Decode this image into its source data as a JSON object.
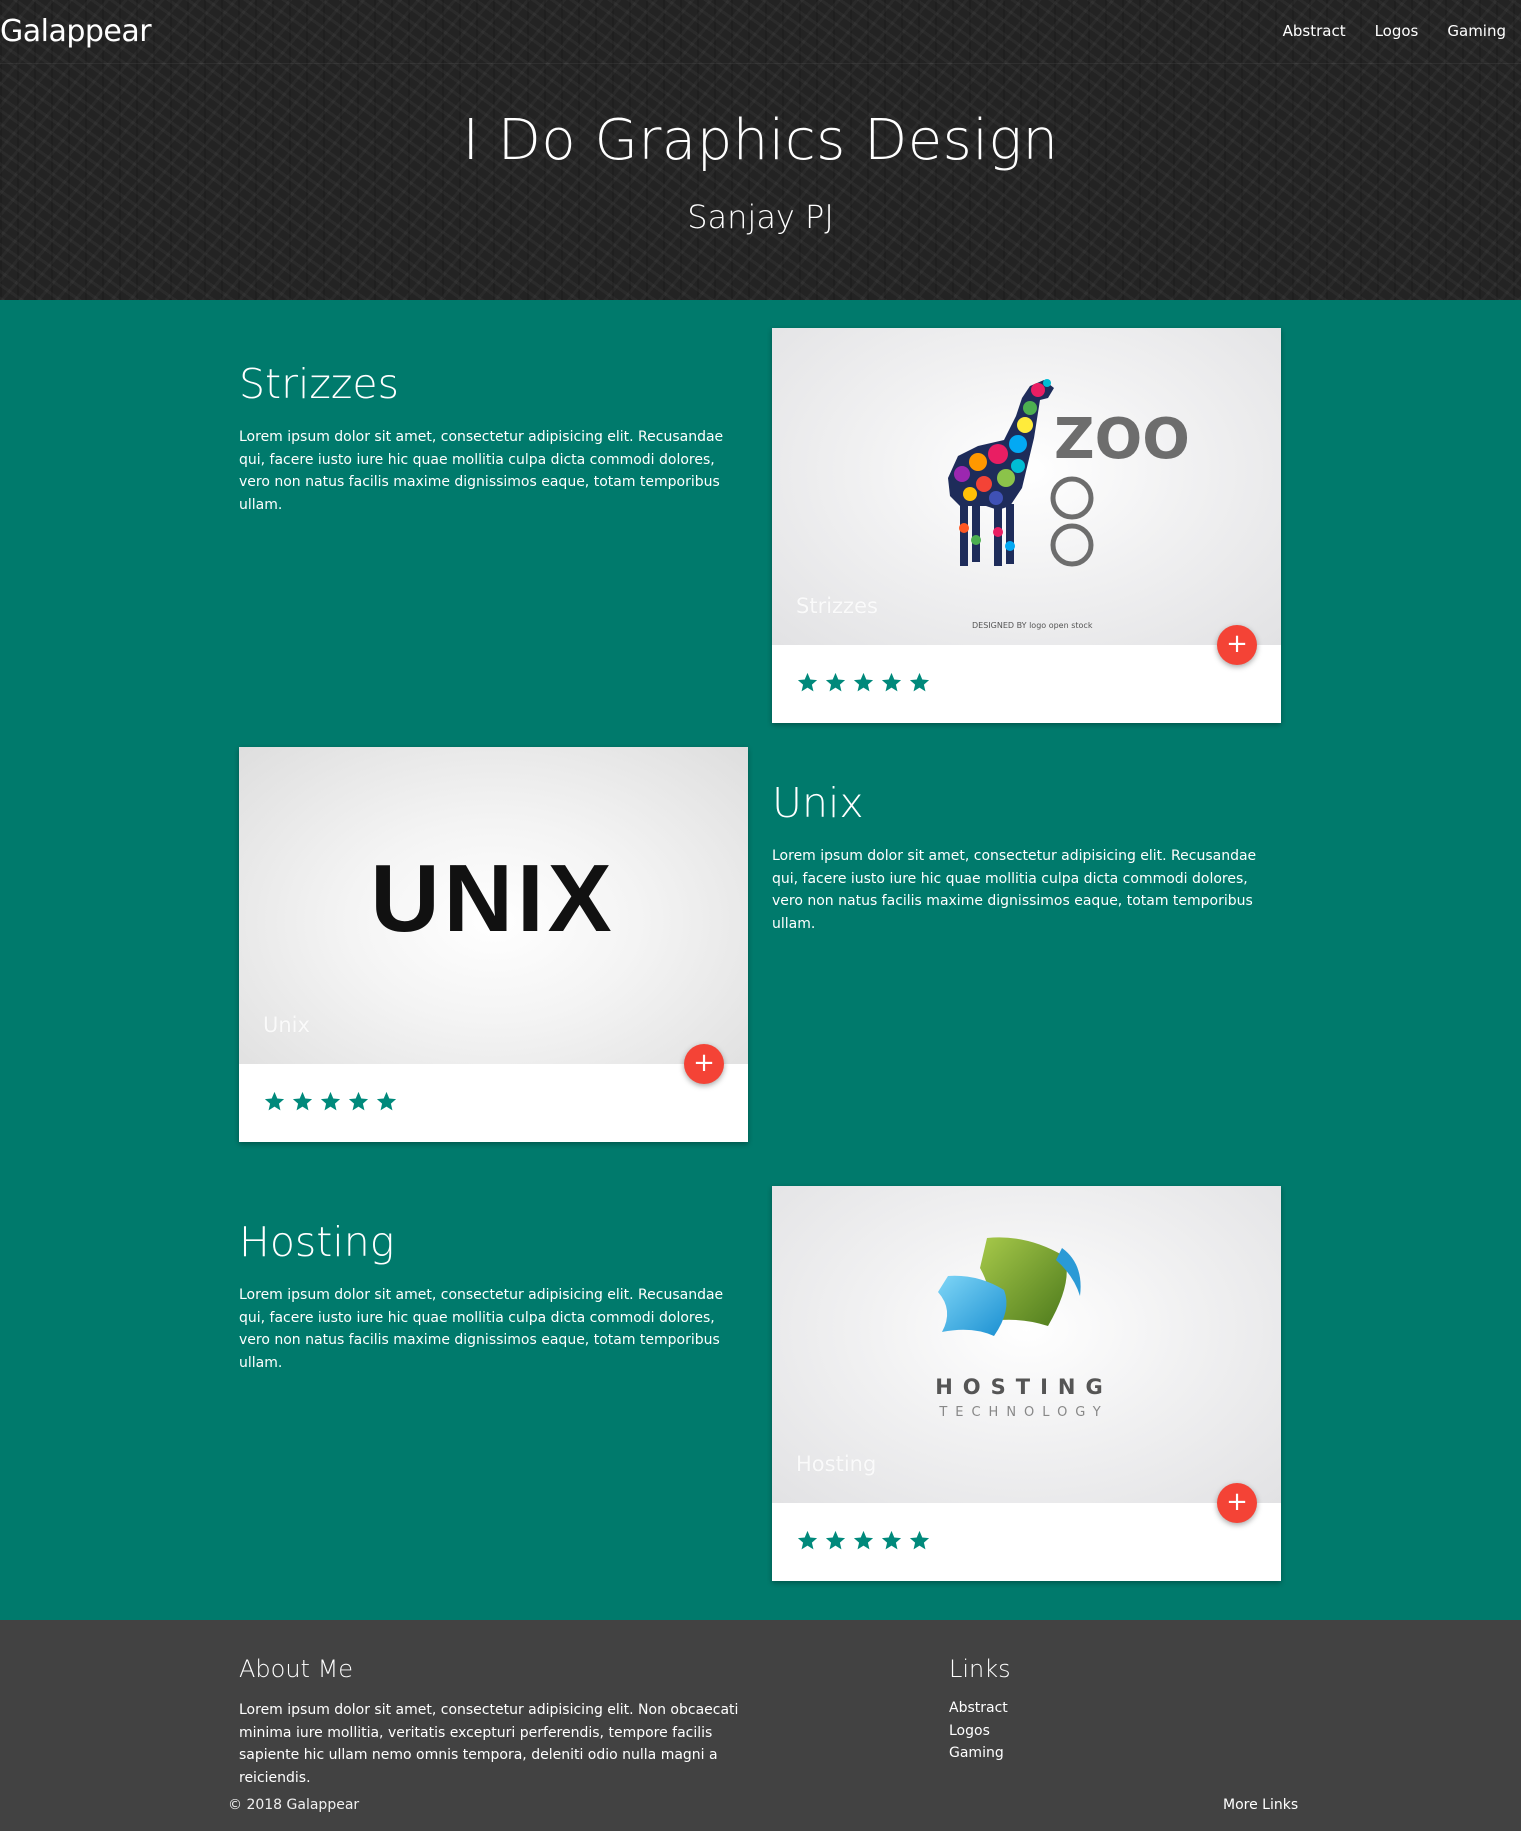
{
  "nav": {
    "brand": "Galappear",
    "links": [
      "Abstract",
      "Logos",
      "Gaming"
    ]
  },
  "hero": {
    "title": "I Do Graphics Design",
    "subtitle": "Sanjay PJ"
  },
  "sections": [
    {
      "title": "Strizzes",
      "text": "Lorem ipsum dolor sit amet, consectetur adipisicing elit. Recusandae qui, facere iusto iure hic quae mollitia culpa dicta commodi dolores, vero non natus facilis maxime dignissimos eaque, totam temporibus ullam.",
      "card_title": "Strizzes",
      "card_logo_text": "ZOO",
      "card_credit": "DESIGNED BY logo open stock",
      "rating": 5,
      "fab_label": "+"
    },
    {
      "title": "Unix",
      "text": "Lorem ipsum dolor sit amet, consectetur adipisicing elit. Recusandae qui, facere iusto iure hic quae mollitia culpa dicta commodi dolores, vero non natus facilis maxime dignissimos eaque, totam temporibus ullam.",
      "card_title": "Unix",
      "card_logo_text": "UNIX",
      "rating": 5,
      "fab_label": "+"
    },
    {
      "title": "Hosting",
      "text": "Lorem ipsum dolor sit amet, consectetur adipisicing elit. Recusandae qui, facere iusto iure hic quae mollitia culpa dicta commodi dolores, vero non natus facilis maxime dignissimos eaque, totam temporibus ullam.",
      "card_title": "Hosting",
      "card_logo_text": "HOSTING",
      "card_logo_sub": "TECHNOLOGY",
      "rating": 5,
      "fab_label": "+"
    }
  ],
  "footer": {
    "about_title": "About Me",
    "about_text": "Lorem ipsum dolor sit amet, consectetur adipisicing elit. Non obcaecati minima iure mollitia, veritatis excepturi perferendis, tempore facilis sapiente hic ullam nemo omnis tempora, deleniti odio nulla magni a reiciendis.",
    "links_title": "Links",
    "links": [
      "Abstract",
      "Logos",
      "Gaming"
    ],
    "copyright": "© 2018 Galappear",
    "more_links": "More Links"
  },
  "colors": {
    "header_bg": "#232323",
    "main_bg": "#007a6c",
    "footer_bg": "#424242",
    "accent_red": "#f44336",
    "star": "#00897b"
  }
}
